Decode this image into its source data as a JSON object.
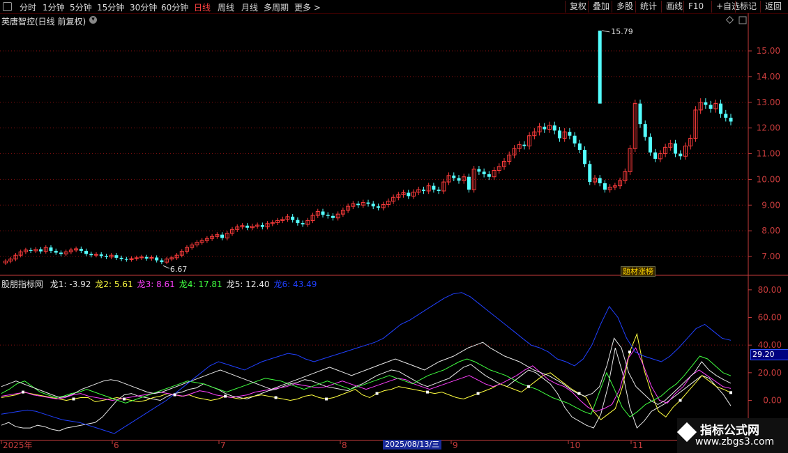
{
  "toolbar": {
    "periods": [
      "分时",
      "1分钟",
      "5分钟",
      "15分钟",
      "30分钟",
      "60分钟",
      "日线",
      "周线",
      "月线",
      "多周期",
      "更多 >"
    ],
    "active_period": "日线",
    "right_buttons": [
      "复权",
      "叠加",
      "多股",
      "统计",
      "画线",
      "F10",
      "+自选",
      "标记",
      "返回"
    ]
  },
  "main_title": "英唐智控(日线 前复权)",
  "indicator": {
    "name": "股朋指标网",
    "values": [
      {
        "label": "龙1: -3.92",
        "color": "#e8e8e8"
      },
      {
        "label": "龙2: 5.61",
        "color": "#ffff40"
      },
      {
        "label": "龙3: 8.61",
        "color": "#ff40ff"
      },
      {
        "label": "龙4: 17.81",
        "color": "#40ff40"
      },
      {
        "label": "龙5: 12.40",
        "color": "#e8e8e8"
      },
      {
        "label": "龙6: 43.49",
        "color": "#2040ff"
      }
    ]
  },
  "badge": "题材涨榜",
  "date_badge": "2025/08/13/三",
  "current_value_tag": "29.20",
  "watermark": {
    "line1": "指标公式网",
    "line2": "www.zbgs3.com"
  },
  "colors": {
    "up": "#ff3c3c",
    "down": "#54ffff",
    "grid": "#8a1010",
    "axis": "#c83c3c",
    "bg": "#000000"
  },
  "chart_data": [
    {
      "type": "candlestick",
      "title": "英唐智控(日线 前复权)",
      "y_ticks": [
        7.0,
        8.0,
        9.0,
        10.0,
        11.0,
        12.0,
        13.0,
        14.0,
        15.0
      ],
      "ylim": [
        6.35,
        15.95
      ],
      "annotations": [
        {
          "label": "15.79",
          "type": "high"
        },
        {
          "label": "6.67",
          "type": "low"
        }
      ],
      "closes": [
        6.82,
        6.9,
        7.05,
        7.18,
        7.25,
        7.22,
        7.28,
        7.2,
        7.35,
        7.22,
        7.15,
        7.1,
        7.18,
        7.25,
        7.3,
        7.22,
        7.1,
        7.05,
        7.08,
        7.02,
        6.98,
        7.05,
        6.95,
        6.9,
        6.88,
        6.92,
        6.95,
        6.98,
        6.92,
        6.96,
        6.85,
        6.78,
        6.9,
        6.95,
        7.05,
        7.2,
        7.35,
        7.45,
        7.55,
        7.62,
        7.7,
        7.78,
        7.85,
        7.72,
        7.9,
        8.05,
        8.15,
        8.2,
        8.12,
        8.18,
        8.22,
        8.15,
        8.28,
        8.32,
        8.4,
        8.45,
        8.55,
        8.42,
        8.3,
        8.25,
        8.4,
        8.6,
        8.75,
        8.62,
        8.58,
        8.5,
        8.65,
        8.8,
        8.95,
        9.05,
        9.0,
        9.1,
        9.05,
        8.95,
        8.9,
        9.02,
        9.15,
        9.3,
        9.4,
        9.48,
        9.35,
        9.5,
        9.6,
        9.55,
        9.75,
        9.6,
        9.55,
        9.9,
        10.15,
        10.05,
        9.95,
        10.1,
        9.6,
        10.4,
        10.3,
        10.2,
        10.1,
        10.35,
        10.5,
        10.7,
        10.95,
        11.2,
        11.35,
        11.3,
        11.7,
        11.85,
        12.05,
        11.95,
        12.1,
        11.9,
        11.6,
        11.85,
        11.7,
        11.4,
        11.15,
        10.6,
        9.9,
        10.05,
        9.85,
        9.6,
        9.7,
        9.75,
        9.95,
        10.3,
        11.2,
        12.95,
        12.15,
        11.65,
        11.05,
        10.8,
        11.0,
        11.25,
        11.4,
        11.0,
        10.9,
        11.3,
        11.6,
        12.7,
        13.0,
        12.9,
        12.75,
        12.95,
        12.55,
        12.4,
        12.25
      ],
      "high": 15.79,
      "low": 6.67
    },
    {
      "type": "line",
      "y_ticks": [
        0.0,
        20.0,
        40.0,
        60.0,
        80.0
      ],
      "ylim": [
        -28,
        88
      ],
      "x_labels": [
        "2025年",
        "6",
        "7",
        "8",
        "9",
        "10",
        "11"
      ],
      "series": [
        {
          "name": "龙1",
          "color": "#e8e8e8",
          "values": [
            -18,
            -16,
            -19,
            -20,
            -20,
            -18,
            -19,
            -21,
            -22,
            -20,
            -19,
            -18,
            -17,
            -16,
            -12,
            -6,
            0,
            4,
            5,
            3,
            2,
            1,
            0,
            3,
            5,
            6,
            8,
            9,
            12,
            10,
            8,
            5,
            3,
            2,
            1,
            3,
            5,
            7,
            8,
            10,
            12,
            13,
            15,
            14,
            12,
            10,
            9,
            8,
            7,
            10,
            12,
            15,
            18,
            20,
            22,
            21,
            18,
            15,
            12,
            10,
            12,
            14,
            16,
            20,
            24,
            26,
            22,
            18,
            15,
            12,
            10,
            14,
            18,
            22,
            20,
            16,
            12,
            5,
            -5,
            -12,
            -15,
            -18,
            -20,
            -10,
            10,
            38,
            20,
            -5,
            -20,
            -15,
            -8,
            -5,
            -2,
            2,
            6,
            10,
            14,
            18,
            16,
            10,
            4,
            -3.92
          ]
        },
        {
          "name": "龙2",
          "color": "#ffff40",
          "values": [
            2,
            3,
            4,
            6,
            5,
            4,
            3,
            2,
            1,
            0,
            1,
            2,
            2,
            -1,
            0,
            1,
            2,
            1,
            0,
            -1,
            0,
            2,
            3,
            5,
            4,
            3,
            4,
            2,
            1,
            0,
            1,
            3,
            2,
            1,
            2,
            3,
            4,
            3,
            2,
            1,
            0,
            1,
            3,
            4,
            2,
            1,
            2,
            4,
            6,
            8,
            4,
            2,
            5,
            7,
            8,
            10,
            9,
            8,
            7,
            6,
            5,
            6,
            4,
            2,
            1,
            3,
            5,
            7,
            9,
            12,
            10,
            8,
            6,
            10,
            14,
            18,
            20,
            16,
            12,
            8,
            5,
            2,
            -8,
            -14,
            -10,
            -6,
            10,
            35,
            48,
            22,
            5,
            -8,
            -12,
            -5,
            0,
            6,
            12,
            18,
            14,
            10,
            8,
            5.61
          ]
        },
        {
          "name": "龙3",
          "color": "#ff40ff",
          "values": [
            3,
            4,
            5,
            6,
            4,
            3,
            2,
            1,
            2,
            4,
            5,
            3,
            2,
            1,
            0,
            1,
            2,
            3,
            4,
            5,
            6,
            5,
            4,
            3,
            5,
            7,
            6,
            4,
            3,
            2,
            3,
            4,
            6,
            7,
            8,
            9,
            10,
            12,
            11,
            10,
            9,
            10,
            12,
            14,
            12,
            10,
            8,
            10,
            12,
            14,
            16,
            15,
            12,
            10,
            8,
            10,
            12,
            14,
            16,
            18,
            15,
            12,
            10,
            12,
            15,
            18,
            22,
            25,
            20,
            15,
            12,
            10,
            6,
            0,
            -5,
            -8,
            -6,
            -3,
            8,
            30,
            38,
            25,
            10,
            0,
            -2,
            5,
            10,
            18,
            22,
            18,
            14,
            10,
            8.61
          ]
        },
        {
          "name": "龙4",
          "color": "#40ff40",
          "values": [
            5,
            8,
            12,
            14,
            10,
            6,
            4,
            2,
            3,
            5,
            6,
            8,
            6,
            4,
            2,
            0,
            -2,
            0,
            2,
            4,
            6,
            8,
            10,
            12,
            14,
            13,
            12,
            10,
            8,
            6,
            8,
            10,
            12,
            14,
            16,
            15,
            14,
            12,
            10,
            8,
            10,
            12,
            14,
            12,
            10,
            8,
            10,
            12,
            14,
            16,
            18,
            16,
            14,
            12,
            15,
            18,
            20,
            22,
            25,
            28,
            30,
            28,
            25,
            22,
            20,
            18,
            15,
            12,
            10,
            8,
            5,
            2,
            0,
            -2,
            -5,
            -8,
            -10,
            5,
            20,
            8,
            -5,
            -12,
            -8,
            -3,
            0,
            3,
            8,
            12,
            18,
            25,
            32,
            30,
            25,
            20,
            17.81
          ]
        },
        {
          "name": "龙5",
          "color": "#e8e8e8",
          "values": [
            10,
            12,
            14,
            12,
            10,
            8,
            6,
            4,
            2,
            3,
            5,
            8,
            10,
            12,
            14,
            15,
            14,
            12,
            10,
            8,
            6,
            5,
            6,
            8,
            10,
            12,
            14,
            16,
            18,
            20,
            22,
            20,
            18,
            16,
            14,
            12,
            10,
            8,
            10,
            12,
            14,
            16,
            18,
            20,
            22,
            24,
            22,
            20,
            18,
            20,
            22,
            24,
            26,
            28,
            30,
            28,
            26,
            24,
            22,
            25,
            28,
            30,
            32,
            35,
            38,
            40,
            42,
            38,
            35,
            32,
            30,
            28,
            25,
            22,
            20,
            18,
            15,
            12,
            8,
            5,
            3,
            5,
            10,
            25,
            45,
            38,
            20,
            10,
            5,
            0,
            -3,
            0,
            5,
            10,
            15,
            20,
            28,
            22,
            18,
            15,
            12.4
          ]
        },
        {
          "name": "龙6",
          "color": "#2040ff",
          "values": [
            -10,
            -9,
            -8,
            -7,
            -8,
            -10,
            -12,
            -14,
            -15,
            -16,
            -18,
            -20,
            -22,
            -24,
            -20,
            -16,
            -12,
            -8,
            -4,
            0,
            5,
            10,
            15,
            20,
            25,
            28,
            26,
            24,
            22,
            25,
            28,
            30,
            32,
            34,
            33,
            30,
            28,
            30,
            32,
            34,
            36,
            38,
            40,
            42,
            45,
            50,
            55,
            58,
            62,
            66,
            70,
            74,
            77,
            78,
            75,
            70,
            65,
            60,
            55,
            50,
            45,
            40,
            38,
            35,
            30,
            28,
            25,
            30,
            40,
            55,
            68,
            60,
            45,
            35,
            32,
            30,
            28,
            32,
            38,
            45,
            52,
            55,
            50,
            45,
            43.49
          ]
        }
      ]
    }
  ]
}
